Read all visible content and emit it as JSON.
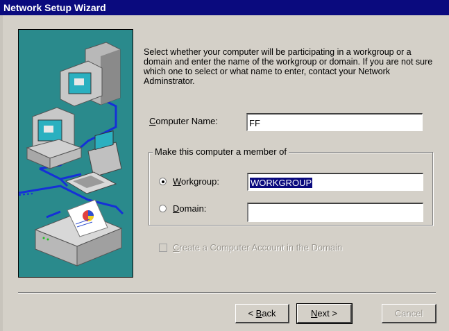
{
  "window": {
    "title": "Network Setup Wizard"
  },
  "description": "Select whether your computer will be participating in a workgroup or a domain and enter the name of the workgroup or domain.  If you are not sure which one to select or what name to enter, contact your Network Adminstrator.",
  "computer_name": {
    "label_prefix": "",
    "label_mnemonic": "C",
    "label_rest": "omputer Name:",
    "value": "FF"
  },
  "membership_group": {
    "title": "Make this computer a member of"
  },
  "workgroup_option": {
    "label_mnemonic": "W",
    "label_rest": "orkgroup:",
    "selected": true,
    "value": "WORKGROUP"
  },
  "domain_option": {
    "label_mnemonic": "D",
    "label_rest": "omain:",
    "selected": false,
    "value": ""
  },
  "create_account_checkbox": {
    "label_mnemonic": "C",
    "label_rest": "reate a Computer Account in the Domain",
    "checked": false,
    "enabled": false
  },
  "buttons": {
    "back": {
      "prefix": "< ",
      "mnemonic": "B",
      "rest": "ack"
    },
    "next": {
      "mnemonic": "N",
      "rest": "ext >"
    },
    "cancel": {
      "label": "Cancel"
    }
  },
  "colors": {
    "title_bar": "#0a0a7e",
    "art_background": "#2a8a8c",
    "dialog": "#d4d0c8"
  }
}
